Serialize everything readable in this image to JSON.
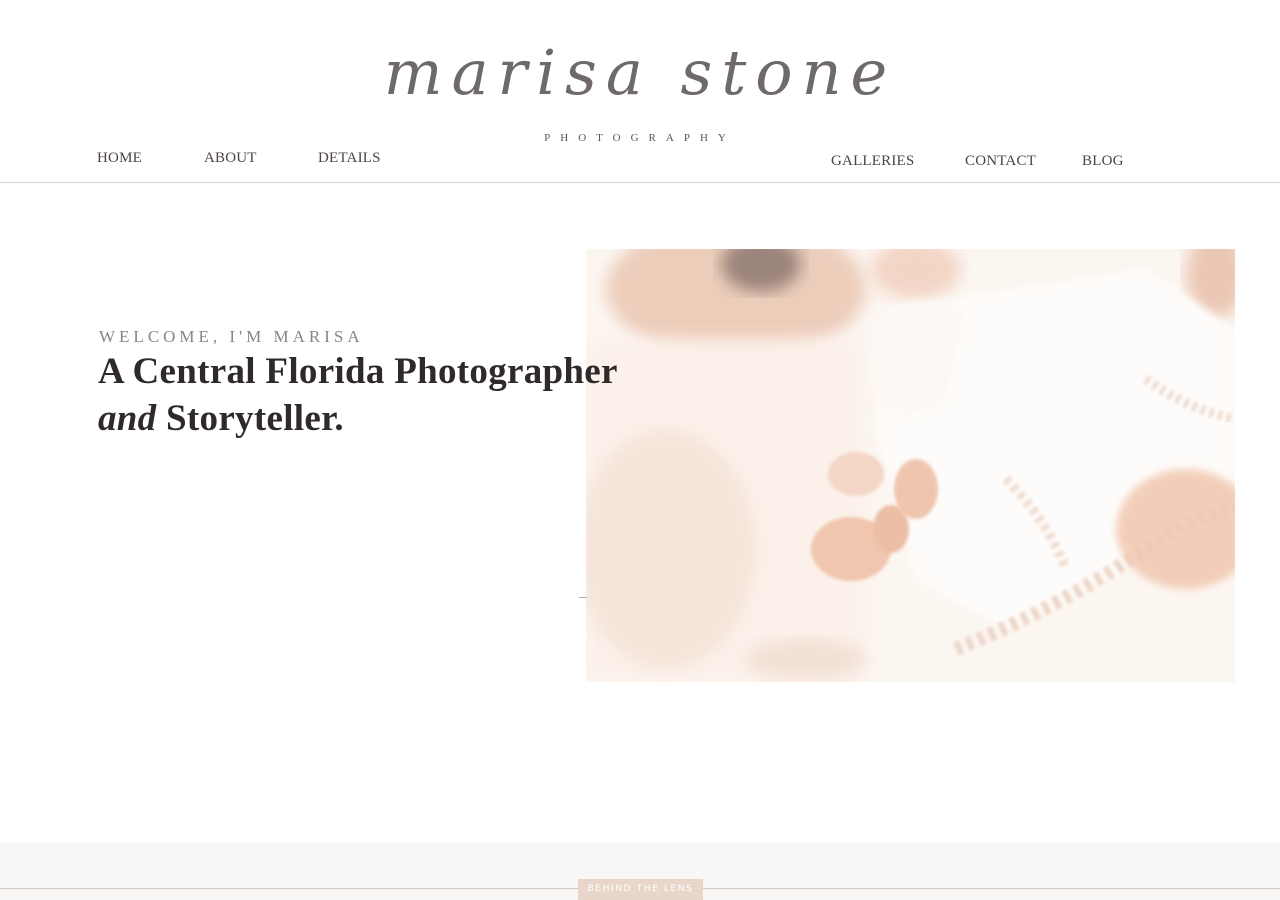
{
  "logo": {
    "script": "marisa stone",
    "subtitle": "PHOTOGRAPHY"
  },
  "nav": {
    "home": "HOME",
    "about": "ABOUT",
    "details": "DETAILS",
    "galleries": "GALLERIES",
    "contact": "CONTACT",
    "blog": "BLOG"
  },
  "hero": {
    "eyebrow": "WELCOME, I'M MARISA",
    "headline_line1": "A Central Florida Photographer",
    "headline_italic": "and",
    "headline_line2_rest": " Storyteller."
  },
  "section2": {
    "tag": "BEHIND THE LENS"
  },
  "colors": {
    "accent_tag": "#e8d6ca",
    "text": "#2f2a29",
    "nav": "#4b4443",
    "rule": "#d6d2cf"
  }
}
